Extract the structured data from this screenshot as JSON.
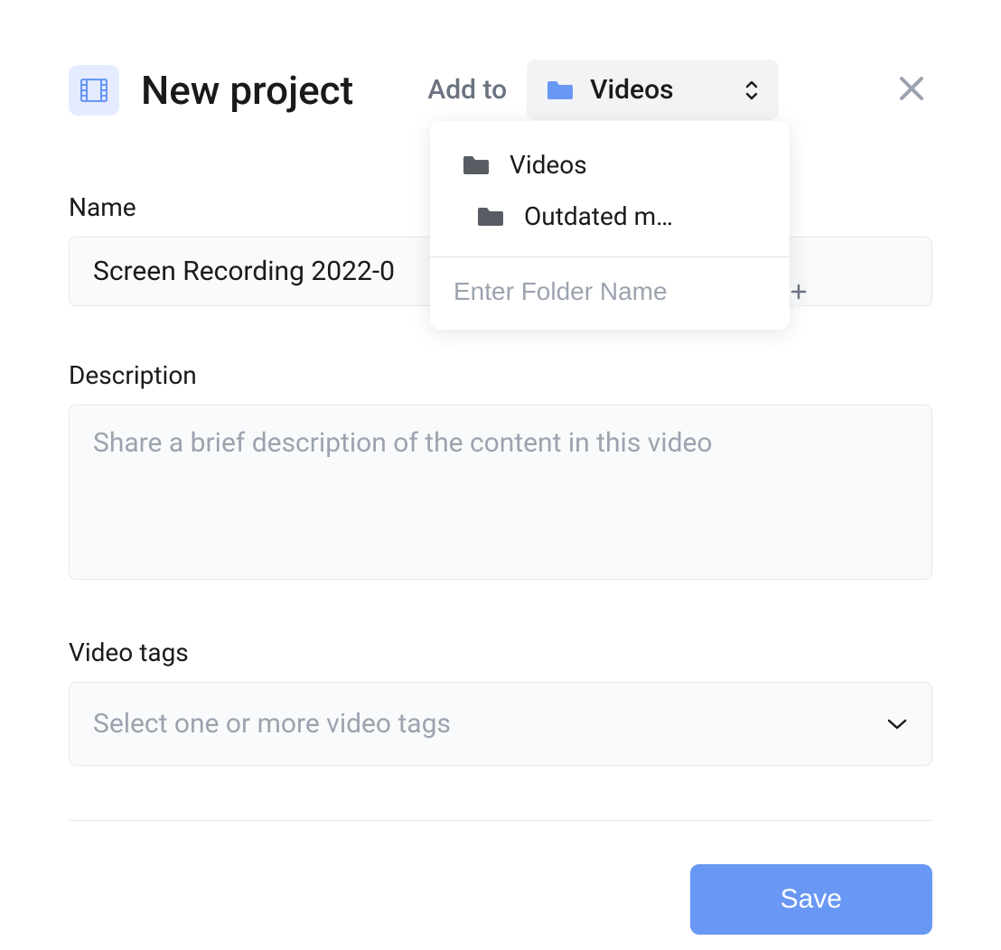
{
  "header": {
    "title": "New project",
    "add_to_label": "Add to",
    "selected_folder": "Videos"
  },
  "dropdown": {
    "items": [
      {
        "label": "Videos",
        "indent": 0
      },
      {
        "label": "Outdated m…",
        "indent": 1
      }
    ],
    "new_folder_placeholder": "Enter Folder Name"
  },
  "fields": {
    "name_label": "Name",
    "name_value": "Screen Recording 2022-0",
    "description_label": "Description",
    "description_placeholder": "Share a brief description of the content in this video",
    "tags_label": "Video tags",
    "tags_placeholder": "Select one or more video tags"
  },
  "actions": {
    "save_label": "Save"
  },
  "colors": {
    "primary": "#6997f4",
    "icon_accent": "#6997f4",
    "icon_box_bg": "#e6ecff",
    "muted": "#6b7280",
    "folder_gray": "#585d64"
  }
}
